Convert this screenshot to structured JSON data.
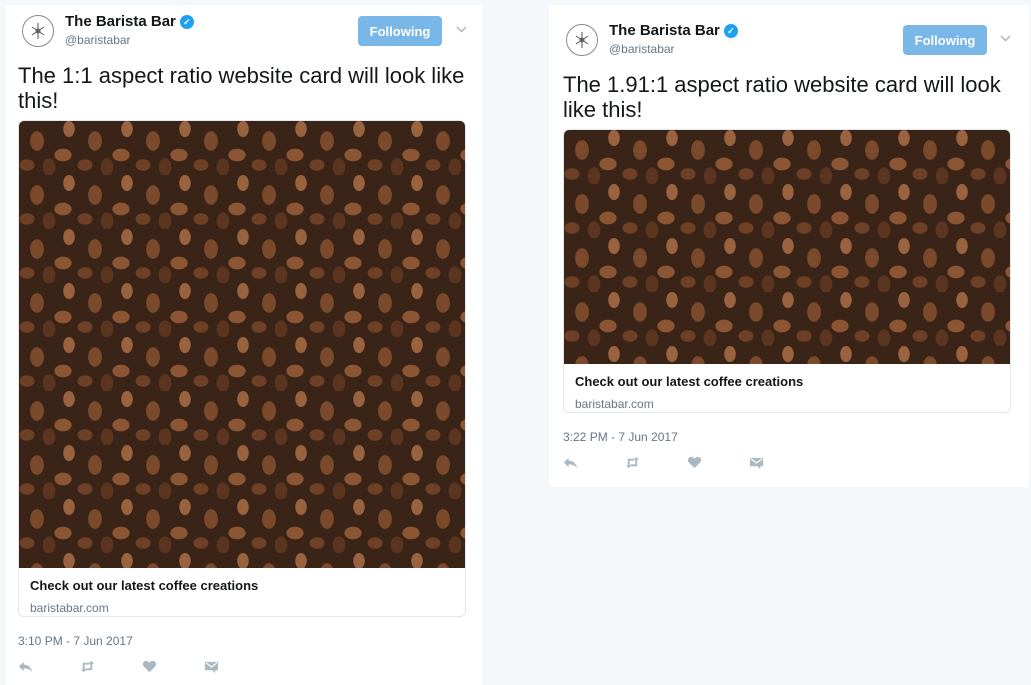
{
  "tweets": [
    {
      "account_name": "The Barista Bar",
      "handle": "@baristabar",
      "follow_label": "Following",
      "text": "The 1:1 aspect ratio website card will look like this!",
      "card": {
        "title": "Check out our latest coffee creations",
        "domain": "baristabar.com"
      },
      "timestamp": "3:10 PM - 7 Jun 2017"
    },
    {
      "account_name": "The Barista Bar",
      "handle": "@baristabar",
      "follow_label": "Following",
      "text": "The 1.91:1 aspect ratio website card will look like this!",
      "card": {
        "title": "Check out our latest coffee creations",
        "domain": "baristabar.com"
      },
      "timestamp": "3:22 PM - 7 Jun 2017"
    }
  ],
  "icons": {
    "verified": "verified-badge-icon",
    "caret": "chevron-down-icon",
    "reply": "reply-icon",
    "retweet": "retweet-icon",
    "like": "heart-icon",
    "dm": "direct-message-icon",
    "avatar": "barista-bar-logo-icon"
  },
  "colors": {
    "following_button": "#79b7e8",
    "verified": "#1da1f2",
    "text": "#14171a",
    "muted": "#657786",
    "page_bg": "#f5f8fa"
  }
}
